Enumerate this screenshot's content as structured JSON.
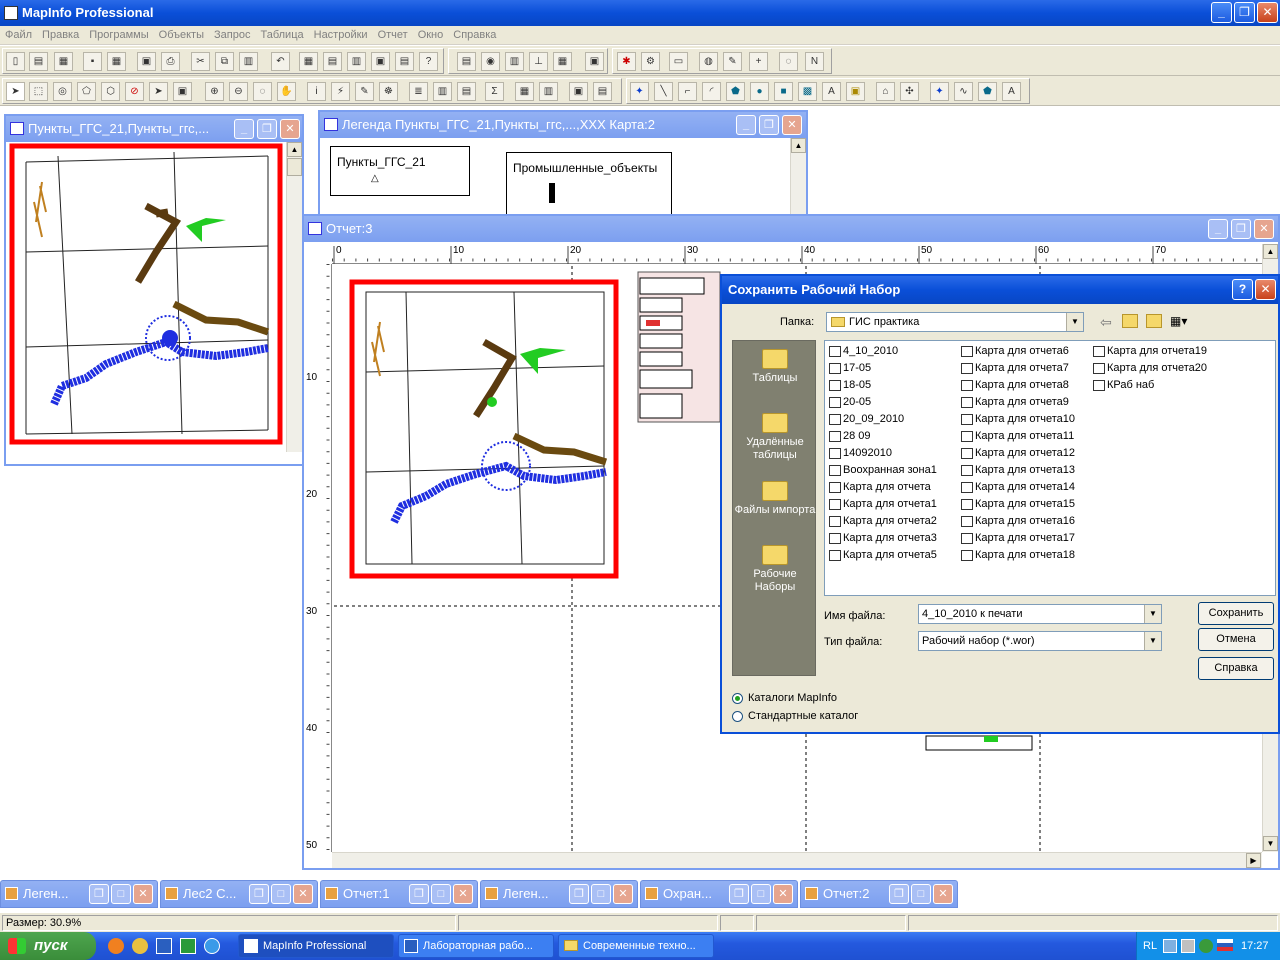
{
  "app": {
    "title": "MapInfo Professional"
  },
  "menu": [
    "Файл",
    "Правка",
    "Программы",
    "Объекты",
    "Запрос",
    "Таблица",
    "Настройки",
    "Отчет",
    "Окно",
    "Справка"
  ],
  "windows": {
    "map": {
      "title": "Пункты_ГГС_21,Пункты_ггс,..."
    },
    "legend": {
      "title": "Легенда Пункты_ГГС_21,Пункты_ггс,...,XXX Карта:2",
      "item1": "Пункты_ГГС_21",
      "item2": "Промышленные_объекты"
    },
    "report": {
      "title": "Отчет:3",
      "ruler_h": [
        "0",
        "10",
        "20",
        "30",
        "40",
        "50",
        "60",
        "70"
      ],
      "ruler_v": [
        "10",
        "20",
        "30",
        "40",
        "50"
      ]
    }
  },
  "dialog": {
    "title": "Сохранить Рабочий Набор",
    "folder_label": "Папка:",
    "folder_value": "ГИС практика",
    "places": [
      "Таблицы",
      "Удалённые таблицы",
      "Файлы импорта",
      "Рабочие Наборы"
    ],
    "files_col1": [
      "4_10_2010",
      "17-05",
      "18-05",
      "20-05",
      "20_09_2010",
      "28 09",
      "14092010",
      "Воохранная зона1",
      "Карта для отчета",
      "Карта для отчета1",
      "Карта для отчета2",
      "Карта для отчета3",
      "Карта для отчета5"
    ],
    "files_col2": [
      "Карта для отчета6",
      "Карта для отчета7",
      "Карта для отчета8",
      "Карта для отчета9",
      "Карта для отчета10",
      "Карта для отчета11",
      "Карта для отчета12",
      "Карта для отчета13",
      "Карта для отчета14",
      "Карта для отчета15",
      "Карта для отчета16",
      "Карта для отчета17",
      "Карта для отчета18"
    ],
    "files_col3": [
      "Карта для отчета19",
      "Карта для отчета20",
      "КРаб наб"
    ],
    "filename_label": "Имя файла:",
    "filename_value": "4_10_2010 к печати",
    "filetype_label": "Тип файла:",
    "filetype_value": "Рабочий набор (*.wor)",
    "save_button": "Сохранить",
    "cancel_button": "Отмена",
    "help_button": "Справка",
    "radio1": "Каталоги MapInfo",
    "radio2": "Стандартные каталог"
  },
  "minimized": [
    "Леген...",
    "Лес2 С...",
    "Отчет:1",
    "Леген...",
    "Охран...",
    "Отчет:2"
  ],
  "status": {
    "zoom": "Размер: 30.9%"
  },
  "taskbar": {
    "start": "пуск",
    "tasks": [
      "MapInfo Professional",
      "Лабораторная рабо...",
      "Современные техно..."
    ],
    "lang": "RL",
    "clock": "17:27"
  },
  "colors": {
    "red_frame": "#ff0000",
    "river": "#1f2ee0",
    "brown": "#8b5a1a",
    "green": "#22cc22"
  }
}
